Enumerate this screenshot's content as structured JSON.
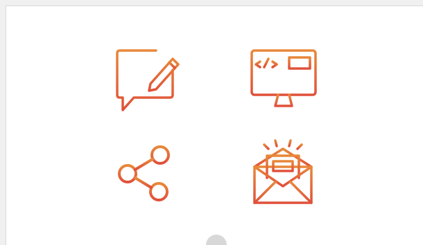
{
  "colors": {
    "gradient_start": "#e8883a",
    "gradient_end": "#e0503a",
    "panel_background": "#ffffff",
    "page_background": "#f0f0f0",
    "scroll_indicator": "#d8d8d8"
  },
  "icons": [
    {
      "name": "chat-edit-icon"
    },
    {
      "name": "code-monitor-icon"
    },
    {
      "name": "share-icon"
    },
    {
      "name": "newsletter-mail-icon"
    }
  ]
}
